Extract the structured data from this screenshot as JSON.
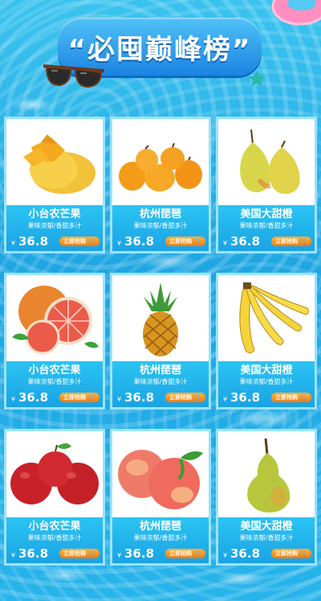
{
  "header": {
    "title": "“必囤巅峰榜”"
  },
  "colors": {
    "background": "#22a9e5",
    "card_info": "#1aa3e4",
    "buy_button": "#f37b12",
    "title_banner": "#1b83e2"
  },
  "products": [
    {
      "name": "小台农芒果",
      "desc": "果味浓郁/香甜多汁",
      "currency": "¥",
      "price": "36.8",
      "buy": "立即抢购",
      "icon": "mango-icon"
    },
    {
      "name": "杭州琵琶",
      "desc": "果味浓郁/香甜多汁",
      "currency": "¥",
      "price": "36.8",
      "buy": "立即抢购",
      "icon": "loquat-icon"
    },
    {
      "name": "美国大甜橙",
      "desc": "果味浓郁/香甜多汁",
      "currency": "¥",
      "price": "36.8",
      "buy": "立即抢购",
      "icon": "pear-icon"
    },
    {
      "name": "小台农芒果",
      "desc": "果味浓郁/香甜多汁",
      "currency": "¥",
      "price": "36.8",
      "buy": "立即抢购",
      "icon": "grapefruit-icon"
    },
    {
      "name": "杭州琵琶",
      "desc": "果味浓郁/香甜多汁",
      "currency": "¥",
      "price": "36.8",
      "buy": "立即抢购",
      "icon": "pineapple-icon"
    },
    {
      "name": "美国大甜橙",
      "desc": "果味浓郁/香甜多汁",
      "currency": "¥",
      "price": "36.8",
      "buy": "立即抢购",
      "icon": "banana-icon"
    },
    {
      "name": "小台农芒果",
      "desc": "果味浓郁/香甜多汁",
      "currency": "¥",
      "price": "36.8",
      "buy": "立即抢购",
      "icon": "apple-icon"
    },
    {
      "name": "杭州琵琶",
      "desc": "果味浓郁/香甜多汁",
      "currency": "¥",
      "price": "36.8",
      "buy": "立即抢购",
      "icon": "peach-icon"
    },
    {
      "name": "美国大甜橙",
      "desc": "果味浓郁/香甜多汁",
      "currency": "¥",
      "price": "36.8",
      "buy": "立即抢购",
      "icon": "pear-icon"
    }
  ]
}
